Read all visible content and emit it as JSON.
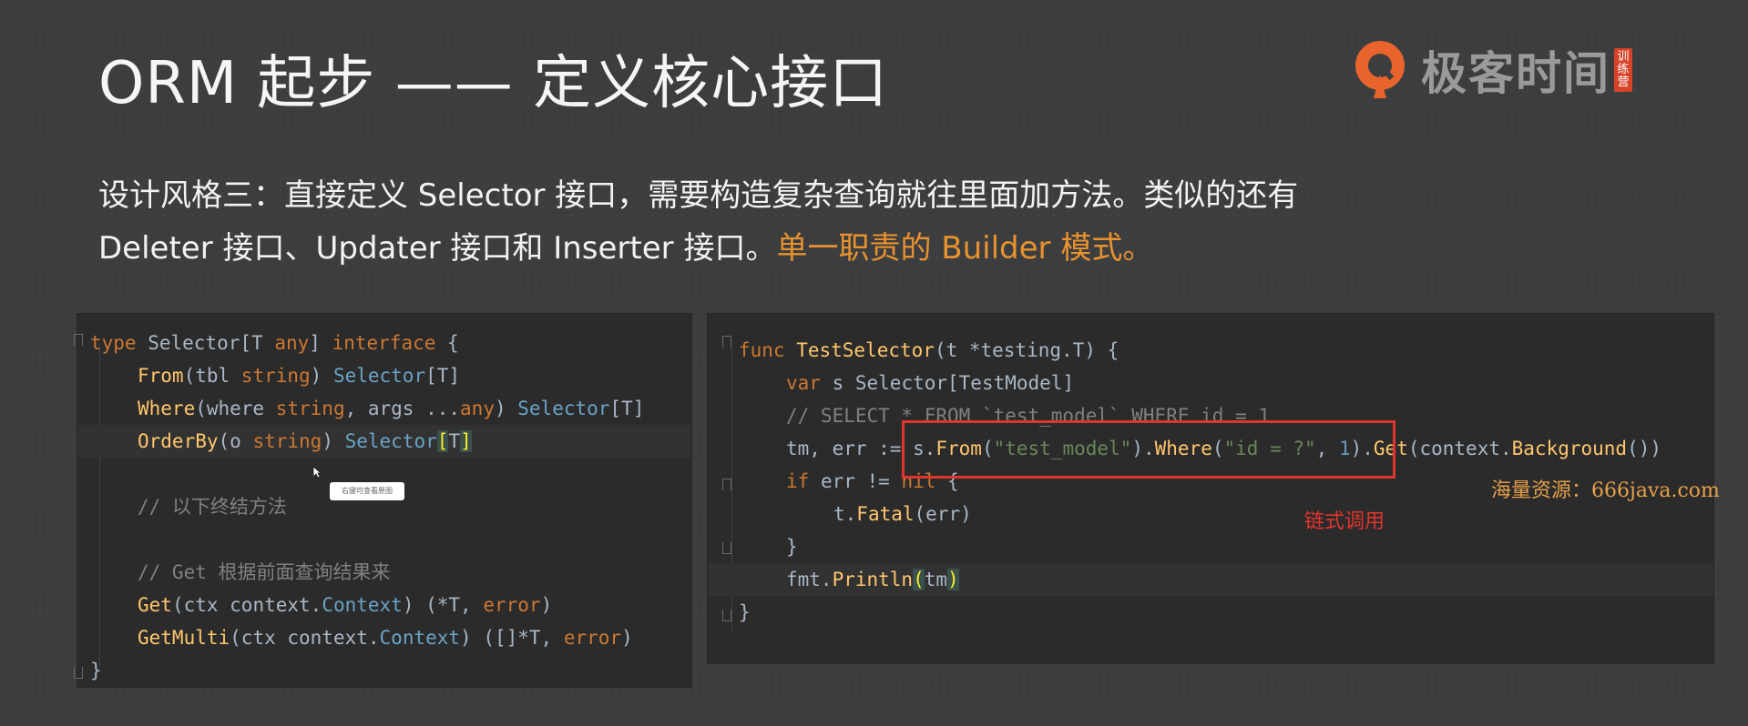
{
  "title": "ORM 起步 —— 定义核心接口",
  "logo": {
    "text": "极客时间",
    "badge": "训练营",
    "icon": "geektime-logo-icon"
  },
  "description": {
    "line1": "设计风格三：直接定义 Selector 接口，需要构造复杂查询就往里面加方法。类似的还有",
    "line2_plain": "Deleter 接口、Updater 接口和 Inserter 接口。",
    "line2_highlight": "单一职责的 Builder 模式。",
    "highlight_color": "#e8922e"
  },
  "left_code": {
    "l1_kw": "type",
    "l1_name": " Selector",
    "l1_open": "[",
    "l1_T": "T",
    "l1_sp": " ",
    "l1_any": "any",
    "l1_close": "]",
    "l1_interface": "interface",
    "l1_brace": " {",
    "l2_fn": "From",
    "l2_args": "(tbl ",
    "l2_type": "string",
    "l2_rp": ") ",
    "l2_ret": "Selector",
    "l2_gen": "[T]",
    "l3_fn": "Where",
    "l3_args": "(where ",
    "l3_type": "string",
    "l3_args2": ", args ...",
    "l3_any": "any",
    "l3_rp": ") ",
    "l3_ret": "Selector",
    "l3_gen": "[T]",
    "l4_fn": "OrderBy",
    "l4_args": "(o ",
    "l4_type": "string",
    "l4_rp": ") ",
    "l4_ret": "Selector",
    "l4_lb": "[",
    "l4_T": "T",
    "l4_rb": "]",
    "l6_comment": "// 以下终结方法",
    "l8_comment": "// Get 根据前面查询结果来",
    "l9_fn": "Get",
    "l9_args": "(ctx context.",
    "l9_ctx": "Context",
    "l9_ret": ") (*T, ",
    "l9_err": "error",
    "l9_end": ")",
    "l10_fn": "GetMulti",
    "l10_args": "(ctx context.",
    "l10_ctx": "Context",
    "l10_ret": ") ([]*T, ",
    "l10_err": "error",
    "l10_end": ")",
    "l11_brace": "}"
  },
  "tooltip_text": "右键可查看原图",
  "right_code": {
    "l1_kw": "func",
    "l1_fn": " TestSelector",
    "l1_args": "(t *testing.T) {",
    "l2_kw": "var",
    "l2_rest": " s Selector[TestModel]",
    "l3_comment": "// SELECT * FROM `test_model` WHERE id = 1",
    "l4_a": "tm, err := s.",
    "l4_from": "From",
    "l4_lp": "(",
    "l4_str1": "\"test_model\"",
    "l4_b": ").",
    "l4_where": "Where",
    "l4_lp2": "(",
    "l4_str2": "\"id = ?\"",
    "l4_c": ", ",
    "l4_num": "1",
    "l4_d": ").",
    "l4_get": "Get",
    "l4_e": "(context.",
    "l4_bg": "Background",
    "l4_f": "())",
    "l5_kw": "if",
    "l5_mid": " err != ",
    "l5_nil": "nil",
    "l5_end": " {",
    "l6_a": "t.",
    "l6_fatal": "Fatal",
    "l6_b": "(err)",
    "l7_brace": "}",
    "l8_a": "fmt.",
    "l8_fn": "Println",
    "l8_lp": "(",
    "l8_arg": "tm",
    "l8_rp": ")",
    "l9_brace": "}"
  },
  "annotation": "链式调用",
  "watermark": "海量资源：666java.com"
}
